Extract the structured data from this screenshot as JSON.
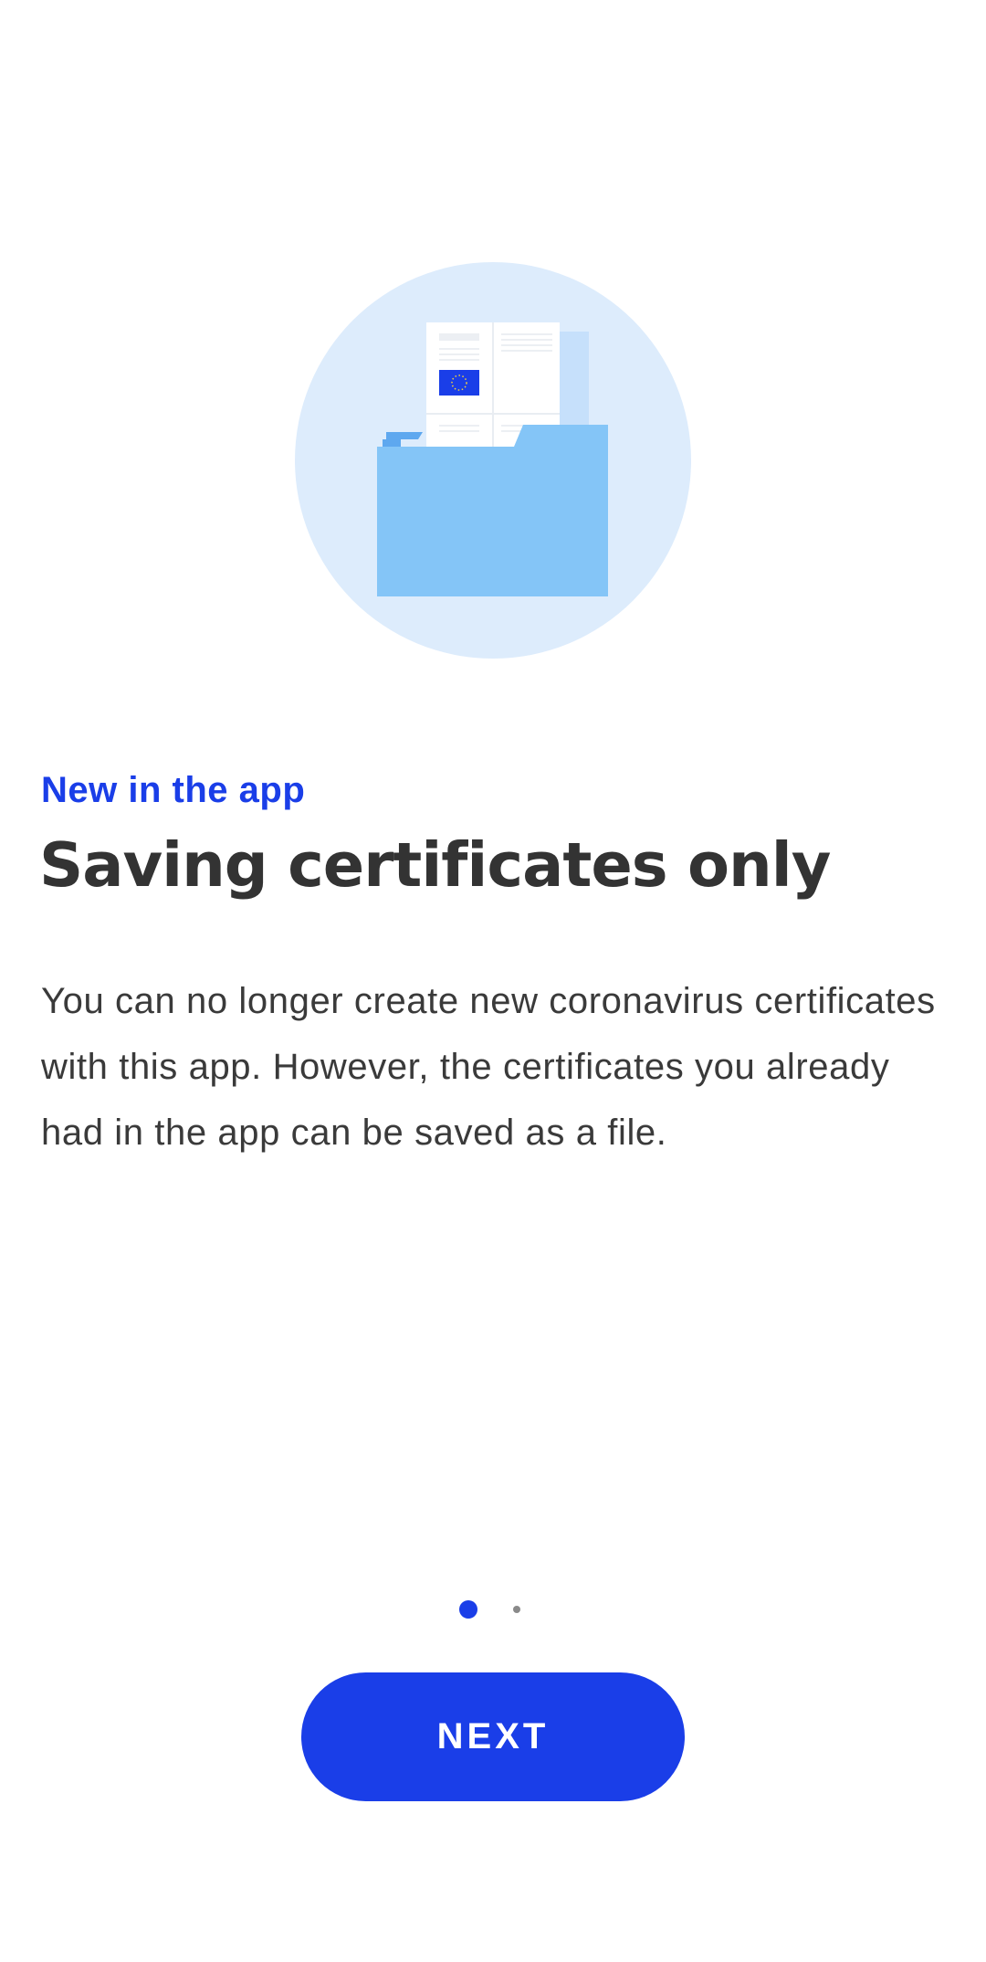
{
  "illustration": {
    "icon": "folder-with-certificate-icon",
    "circle_color": "#ddecfc",
    "folder_color": "#84c5f7",
    "eu_flag_color": "#1a3ee8"
  },
  "onboarding": {
    "overline": "New in the app",
    "title": "Saving certificates only",
    "body": "You can no longer create new coronavirus certificates with this app. However, the certificates you already had in the app can be saved as a file."
  },
  "pager": {
    "current_page": 1,
    "total_pages": 2
  },
  "actions": {
    "next_label": "NEXT"
  },
  "colors": {
    "accent": "#1a3ee8",
    "title_text": "#333333",
    "body_text": "#3a3a3a"
  }
}
